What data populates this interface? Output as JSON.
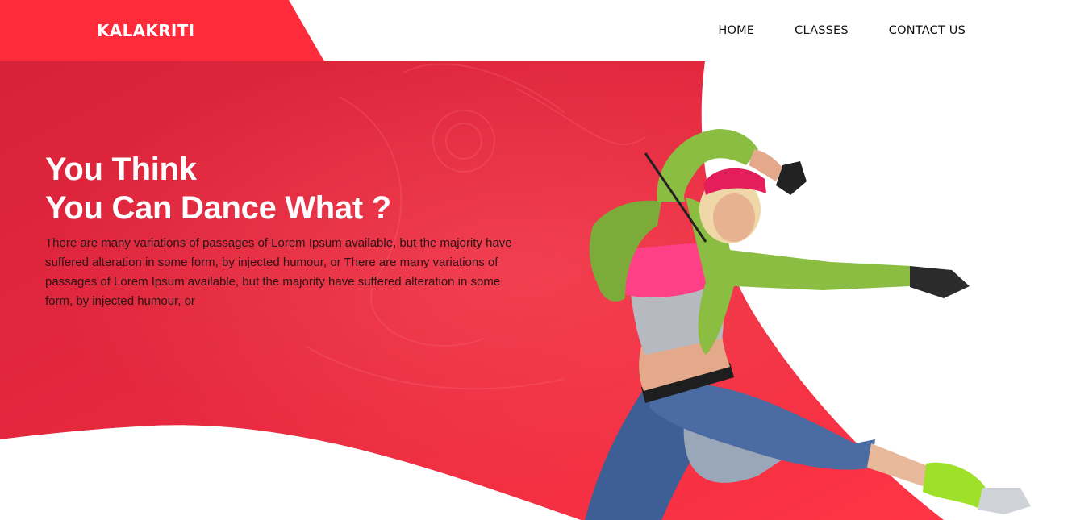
{
  "header": {
    "brand": "KALAKRITI",
    "nav": [
      {
        "label": "HOME"
      },
      {
        "label": "CLASSES"
      },
      {
        "label": "CONTACT US"
      }
    ]
  },
  "hero": {
    "title_line1": "You Think",
    "title_line2": "You Can Dance What ?",
    "description": "There are many variations of passages of Lorem Ipsum available, but the majority have suffered alteration in some form, by injected humour, or There are many variations of passages of Lorem Ipsum available, but the majority have suffered alteration in some form, by injected humour, or"
  },
  "colors": {
    "accent": "#fe2b3b",
    "hero_dark": "#d8223a",
    "text_dark": "#111111",
    "background": "#ffffff"
  },
  "icons": {
    "hero_image": "dancer-image"
  }
}
